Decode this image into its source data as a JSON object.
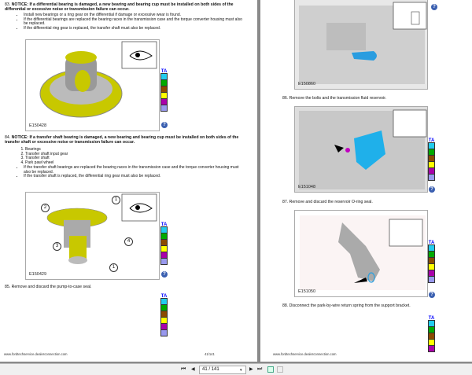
{
  "left_page": {
    "step83": {
      "num": "83.",
      "notice": "NOTICE: If a differential bearing is damaged, a new bearing and bearing cup must be installed on both sides of the differential or excessive noise or transmission failure can occur.",
      "bullets": [
        "Install new bearings or a ring gear on the differential if damage or excessive wear is found.",
        "If the differential bearings are replaced the bearing races in the transmission case and the torque converter housing must also be replaced.",
        "If the differential ring gear is replaced, the transfer shaft must also be replaced."
      ],
      "figure_id": "E150428"
    },
    "step84": {
      "num": "84.",
      "notice": "NOTICE: If a transfer shaft bearing is damaged, a new bearing and bearing cup must be installed on both sides of the transfer shaft or excessive noise or transmission failure can occur.",
      "items": [
        "Bearings",
        "Transfer shaft input gear",
        "Transfer shaft",
        "Park pawl wheel"
      ],
      "bullets": [
        "If the transfer shaft bearings are replaced the bearing races in the transmission case and the torque converter housing must also be replaced.",
        "If the transfer shaft is replaced, the differential ring gear must also be replaced."
      ],
      "figure_id": "E150429",
      "callouts": [
        "1",
        "2",
        "3",
        "4",
        "1"
      ]
    },
    "step85": {
      "num": "85.",
      "text": "Remove and discard the pump-to-case seal."
    },
    "footer_url": "www.fordtechservice.dealerconnection.com",
    "footer_page": "41/141"
  },
  "right_page": {
    "fig_top_id": "E150860",
    "step86": {
      "num": "86.",
      "text": "Remove the bolts and the transmission fluid reservoir.",
      "figure_id": "E151048"
    },
    "step87": {
      "num": "87.",
      "text": "Remove and discard the reservoir O-ring seal.",
      "figure_id": "E151050"
    },
    "step88": {
      "num": "88.",
      "text": "Disconnect the park-by-wire return spring from the support bracket."
    },
    "footer_url": "www.fordtechservice.dealerconnection.com"
  },
  "swatch_colors": [
    "#22ccee",
    "#00aa00",
    "#8b4a00",
    "#ffff00",
    "#aa00aa",
    "#9999ee"
  ],
  "strip_tag": "TA",
  "help_glyph": "?",
  "toolbar": {
    "page_value": "41 / 141",
    "first": "⏮",
    "prev": "◀",
    "next": "▶",
    "last": "⏭"
  }
}
